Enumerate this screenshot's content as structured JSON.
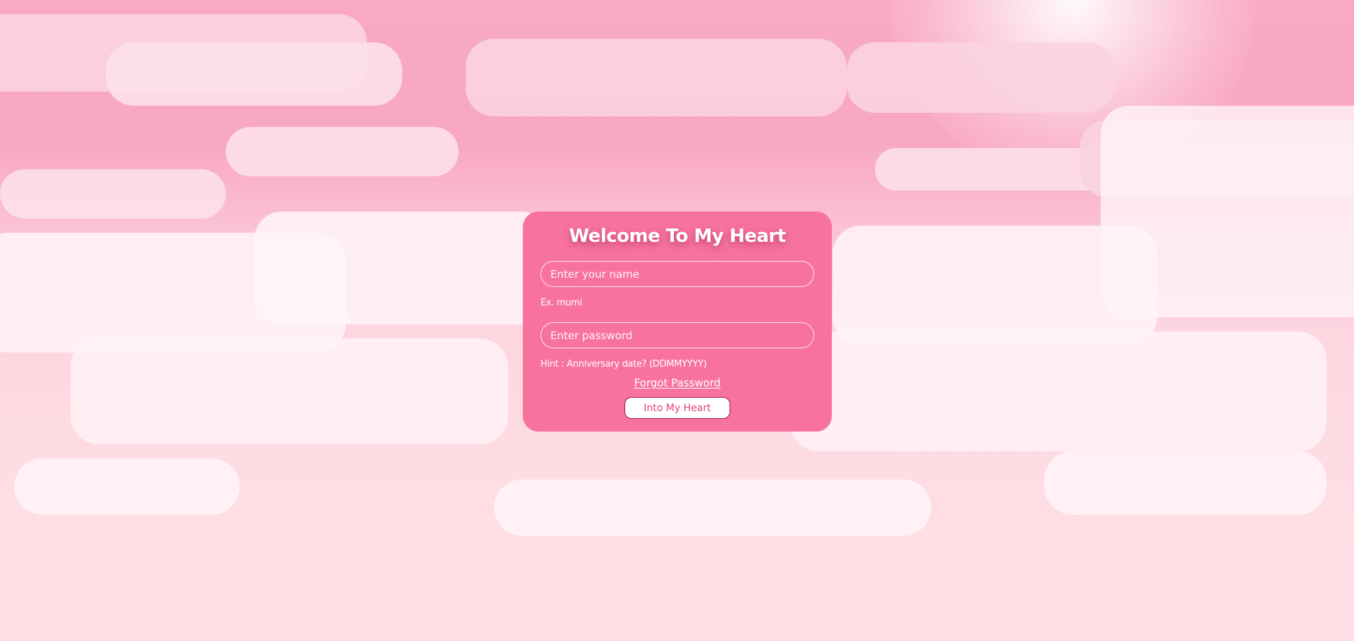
{
  "login": {
    "title": "Welcome To My Heart",
    "name_placeholder": "Enter your name",
    "name_hint": "Ex. mumi",
    "password_placeholder": "Enter password",
    "password_hint": "Hint : Anniversary date? (DDMMYYYY)",
    "forgot_link": "Forgot Password",
    "submit_label": "Into My Heart"
  },
  "colors": {
    "card_background": "#f7739d",
    "sky_pink": "#f9a9c3",
    "cloud_white": "#fff4f8",
    "button_text": "#e8407c",
    "button_border": "#a3164c"
  }
}
